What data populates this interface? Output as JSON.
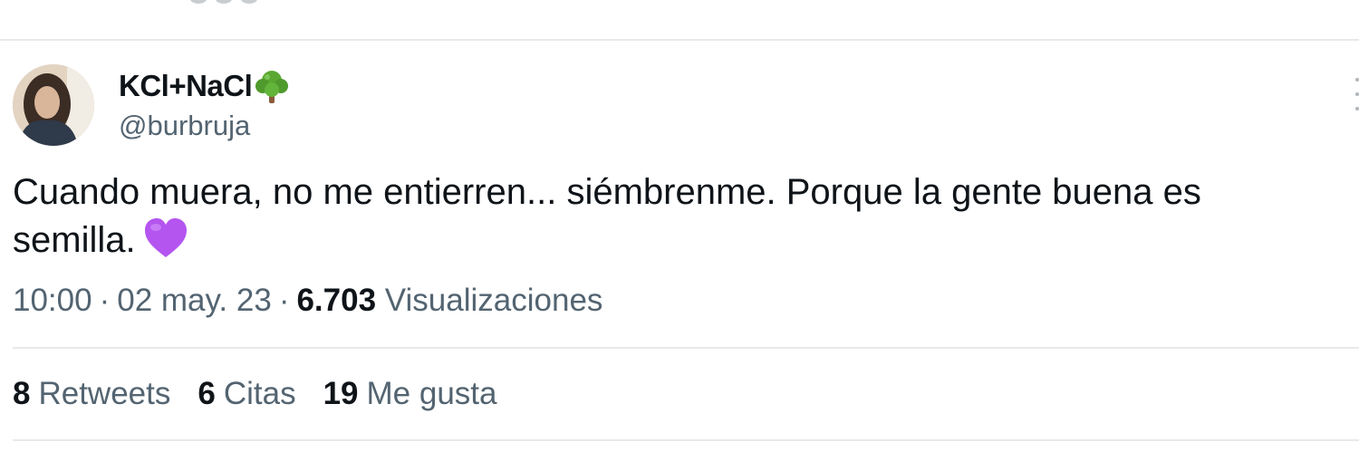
{
  "author": {
    "display_name": "KCl+NaCl",
    "handle": "@burbruja"
  },
  "tweet": {
    "text_line1": "Cuando muera, no me entierren... siémbrenme. Porque la gente buena es",
    "text_line2": "semilla."
  },
  "meta": {
    "time": "10:00",
    "separator": "·",
    "date": "02 may. 23",
    "views_count": "6.703",
    "views_label": "Visualizaciones"
  },
  "stats": {
    "retweets_count": "8",
    "retweets_label": "Retweets",
    "quotes_count": "6",
    "quotes_label": "Citas",
    "likes_count": "19",
    "likes_label": "Me gusta"
  },
  "icons": {
    "name_emoji": "deciduous-tree-icon",
    "text_emoji": "purple-heart-icon",
    "menu": "more-options-icon"
  },
  "colors": {
    "primary_text": "#0f1419",
    "secondary_text": "#536471",
    "divider": "#e7e9ea",
    "heart": "#b455f0",
    "tree_leaves": "#5aa832",
    "tree_trunk": "#8a5a3c"
  }
}
